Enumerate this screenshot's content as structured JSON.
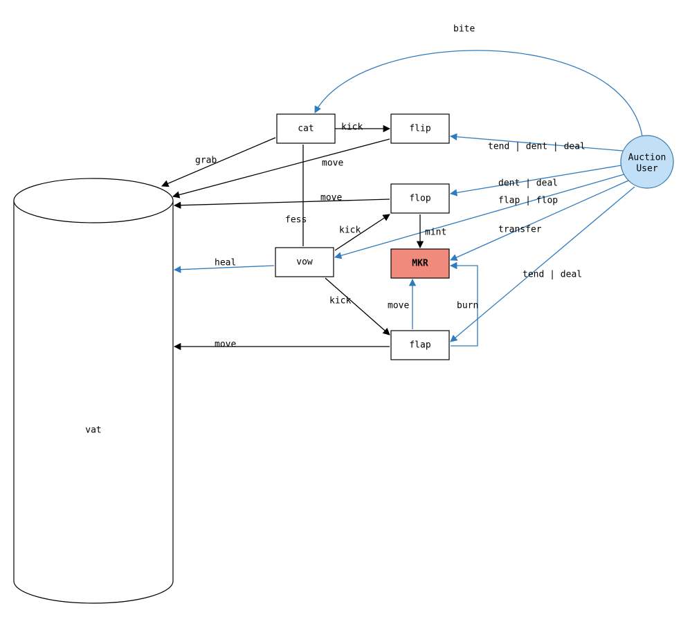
{
  "nodes": {
    "vat": {
      "label": "vat"
    },
    "cat": {
      "label": "cat"
    },
    "flip": {
      "label": "flip"
    },
    "flop": {
      "label": "flop"
    },
    "vow": {
      "label": "vow"
    },
    "mkr": {
      "label": "MKR"
    },
    "flap": {
      "label": "flap"
    },
    "user": {
      "line1": "Auction",
      "line2": "User"
    }
  },
  "edges": {
    "bite": "bite",
    "kick_cat_flip": "kick",
    "tend_dent_deal": "tend | dent | deal",
    "grab": "grab",
    "move1": "move",
    "dent_deal": "dent | deal",
    "move2": "move",
    "flap_flop": "flap | flop",
    "fess": "fess",
    "kick_vow_flop": "kick",
    "mint": "mint",
    "transfer": "transfer",
    "heal": "heal",
    "tend_deal": "tend | deal",
    "kick_vow_flap": "kick",
    "move_flap_mkr": "move",
    "burn": "burn",
    "move3": "move"
  }
}
